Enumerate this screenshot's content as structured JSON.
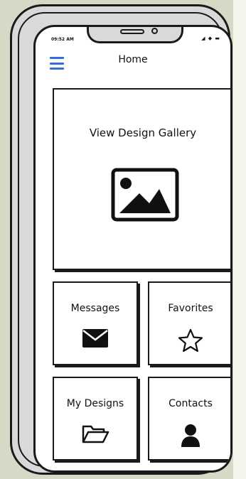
{
  "status": {
    "time": "09:52 AM",
    "signal_icons": "◢ ◆ ▬"
  },
  "header": {
    "title": "Home",
    "menu_icon": "hamburger-icon"
  },
  "tiles": {
    "gallery": {
      "label": "View Design Gallery",
      "icon": "image-icon"
    },
    "messages": {
      "label": "Messages",
      "icon": "envelope-icon"
    },
    "favorites": {
      "label": "Favorites",
      "icon": "star-icon"
    },
    "my_designs": {
      "label": "My Designs",
      "icon": "folder-open-icon"
    },
    "contacts": {
      "label": "Contacts",
      "icon": "user-icon"
    }
  },
  "colors": {
    "accent": "#2f6fd6",
    "backdrop": "#d6d9c5",
    "frame": "#d9d9d9"
  }
}
